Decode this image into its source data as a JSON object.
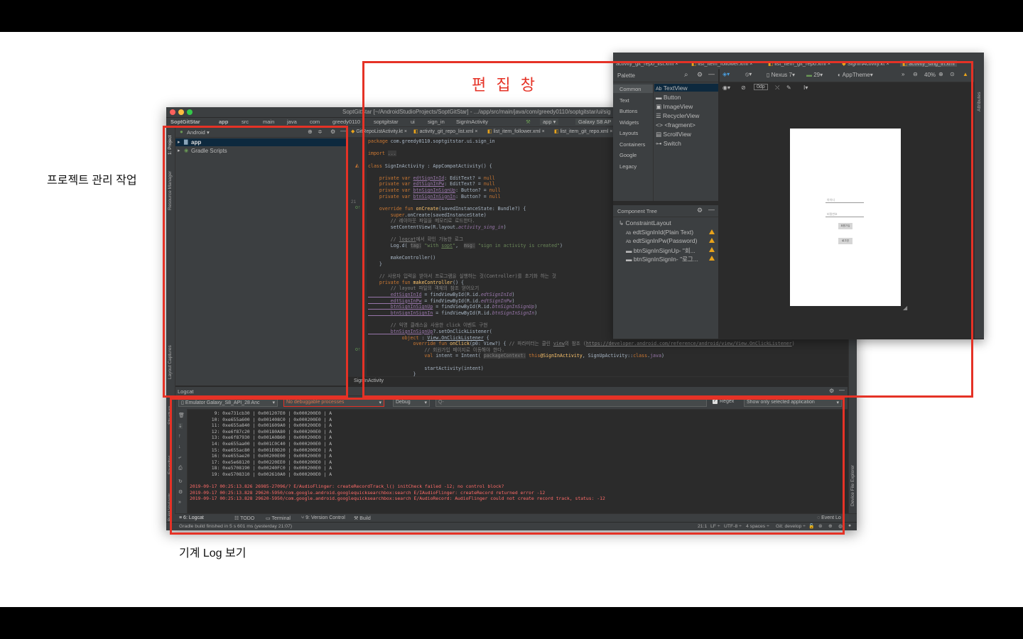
{
  "annotations": {
    "project_label": "프로젝트 관리 작업",
    "log_label": "기계 Log 보기",
    "editor_label": "편 집 창"
  },
  "ide": {
    "title": "SoptGitStar [~/AndroidStudioProjects/SoptGitStar] - .../app/src/main/java/com/greedy0110/soptgitstar/ui/sig",
    "breadcrumbs": [
      "SoptGitStar",
      "app",
      "src",
      "main",
      "java",
      "com",
      "greedy0110",
      "soptgitstar",
      "ui",
      "sign_in",
      "SignInActivity"
    ],
    "run_config": "app",
    "device": "Galaxy S8 AP",
    "left_tool_windows": [
      "1: Project",
      "Resource Manager",
      "Layout Captures",
      "Structure",
      "Favorites",
      "Build Variants"
    ],
    "project_panel": {
      "view_mode": "Android",
      "items": [
        "app",
        "Gradle Scripts"
      ]
    },
    "editor_tabs": [
      "GitRepoListActivity.kt",
      "activity_git_repo_list.xml",
      "list_item_follower.xml",
      "list_item_git_repo.xml"
    ],
    "code_lines": [
      [
        "package com.greedy0110.soptgitstar.ui.sign_in"
      ],
      [
        ""
      ],
      [
        "import ..."
      ],
      [
        ""
      ],
      [
        "class SignInActivity : AppCompatActivity() {"
      ],
      [
        ""
      ],
      [
        "    private var edtSignInId: EditText? = null"
      ],
      [
        "    private var edtSignInPw: EditText? = null"
      ],
      [
        "    private var btnSignInSignUp: Button? = null"
      ],
      [
        "    private var btnSignInSignIn: Button? = null"
      ],
      [
        ""
      ],
      [
        "    override fun onCreate(savedInstanceState: Bundle?) {"
      ],
      [
        "        super.onCreate(savedInstanceState)"
      ],
      [
        "        // 레이아웃 파일을 메모리로 로드한다."
      ],
      [
        "        setContentView(R.layout.activity_sing_in)"
      ],
      [
        ""
      ],
      [
        "        // logcat에서 확인 가능한 로그"
      ],
      [
        "        Log.d( tag: \"with sopt\",  msg: \"sign in activity is created\")"
      ],
      [
        ""
      ],
      [
        "        makeController()"
      ],
      [
        "    }"
      ],
      [
        ""
      ],
      [
        "    // 사용자 입력을 받아서 프로그램을 실행하는 것(Controller)를 초기화 하는 것"
      ],
      [
        "    private fun makeController() {"
      ],
      [
        "        // layout 파일의 객체의 참조 얻어오기"
      ],
      [
        "        edtSignInId = findViewById(R.id.edtSignInId)"
      ],
      [
        "        edtSignInPw = findViewById(R.id.edtSignInPw)"
      ],
      [
        "        btnSignInSignUp = findViewById(R.id.btnSignInSignUp)"
      ],
      [
        "        btnSignInSignIn = findViewById(R.id.btnSignInSignIn)"
      ],
      [
        ""
      ],
      [
        "        // 익명 클래스을 사용한 click 이벤트 구현"
      ],
      [
        "        btnSignInSignUp?.setOnClickListener("
      ],
      [
        "            object : View.OnClickListener {"
      ],
      [
        "                override fun onClick(p0: View?) { // 파라미터는 클린 view의 참조 (https://developer.android.com/reference/android/view/View.OnClickListener)"
      ],
      [
        "                    // 회원가입 페이지로 이동해야 한다."
      ],
      [
        "                    val intent = Intent( packageContext: this@SignInActivity, SignUpActivity::class.java)"
      ],
      [
        ""
      ],
      [
        "                    startActivity(intent)"
      ],
      [
        "                }"
      ]
    ],
    "line_number_marker": "21",
    "editor_footer": "SignInActivity",
    "logcat": {
      "title": "Logcat",
      "device": "Emulator Galaxy_S8_API_28 Anc",
      "process": "No debuggable processes",
      "level": "Debug",
      "search_placeholder": "Q-",
      "regex_label": "Regex",
      "filter": "Show only selected application",
      "lines": [
        "         9: 0xe731cb30 | 0x001207E0 | 0x000200E0 | A",
        "        10: 0xe655a600 | 0x001408C0 | 0x000200E0 | A",
        "        11: 0xe655a840 | 0x001609A0 | 0x000200E0 | A",
        "        12: 0xe6f87c20 | 0x00180A80 | 0x000200E0 | A",
        "        13: 0xe6f87930 | 0x001A0B60 | 0x000200E0 | A",
        "        14: 0xe655aa00 | 0x001C0C40 | 0x000200E0 | A",
        "        15: 0xe655ac80 | 0x001E0D20 | 0x000200E0 | A",
        "        16: 0xe655ae20 | 0x00200E00 | 0x000200E0 | A",
        "        17: 0xe5e68120 | 0x00220EE0 | 0x000200E0 | A",
        "        18: 0xe5708190 | 0x00240FC0 | 0x000200E0 | A",
        "        19: 0xe5708310 | 0x002610A0 | 0x000200E0 | A"
      ],
      "errors": [
        "2019-09-17 00:25:13.826 26985-27096/? E/AudioFlinger: createRecordTrack_l() initCheck failed -12; no control block?",
        "2019-09-17 00:25:13.828 29620-5950/com.google.android.googlequicksearchbox:search E/IAudioFlinger: createRecord returned error -12",
        "2019-09-17 00:25:13.828 29620-5950/com.google.android.googlequicksearchbox:search E/AudioRecord: AudioFlinger could not create record track, status: -12"
      ]
    },
    "bottom_tabs": [
      "6: Logcat",
      "TODO",
      "Terminal",
      "9: Version Control",
      "Build"
    ],
    "event_log": "Event Lo",
    "right_tool_windows": [
      "Device File Explorer"
    ],
    "status": {
      "message": "Gradle build finished in 5 s 601 ms (yesterday 21:07)",
      "position": "21:1",
      "line_sep": "LF ÷",
      "encoding": "UTF-8 ÷",
      "indent": "4 spaces ÷",
      "git": "Git: develop ÷"
    }
  },
  "layout_editor": {
    "tabs": [
      "activity_git_repo_list.xml",
      "list_item_follower.xml",
      "list_item_git_repo.xml",
      "SignInActivity.kt",
      "activity_sing_in.xml"
    ],
    "palette_title": "Palette",
    "categories": [
      "Common",
      "Text",
      "Buttons",
      "Widgets",
      "Layouts",
      "Containers",
      "Google",
      "Legacy"
    ],
    "palette_items": [
      "TextView",
      "Button",
      "ImageView",
      "RecyclerView",
      "<fragment>",
      "ScrollView",
      "Switch"
    ],
    "toolbar": {
      "device": "Nexus 7",
      "api": "29",
      "theme": "AppTheme",
      "zoom": "40%",
      "margin": "0dp"
    },
    "component_tree_title": "Component Tree",
    "component_tree": [
      "ConstraintLayout",
      "edtSignInId(Plain Text)",
      "edtSignInPw(Password)",
      "btnSignInSignUp- \"회...",
      "btnSignInSignIn- \"로그..."
    ],
    "preview": {
      "id_hint": "아이디",
      "pw_hint": "비밀번호",
      "signup_btn": "회원가입",
      "signin_btn": "로그인"
    },
    "right_tool_windows": [
      "Attributes"
    ]
  },
  "colors": {
    "highlight_red": "#e53226",
    "ide_bg": "#2b2b2b",
    "panel_bg": "#3c3f41",
    "warning": "#e8a31b",
    "log_error": "#ff6b68"
  }
}
